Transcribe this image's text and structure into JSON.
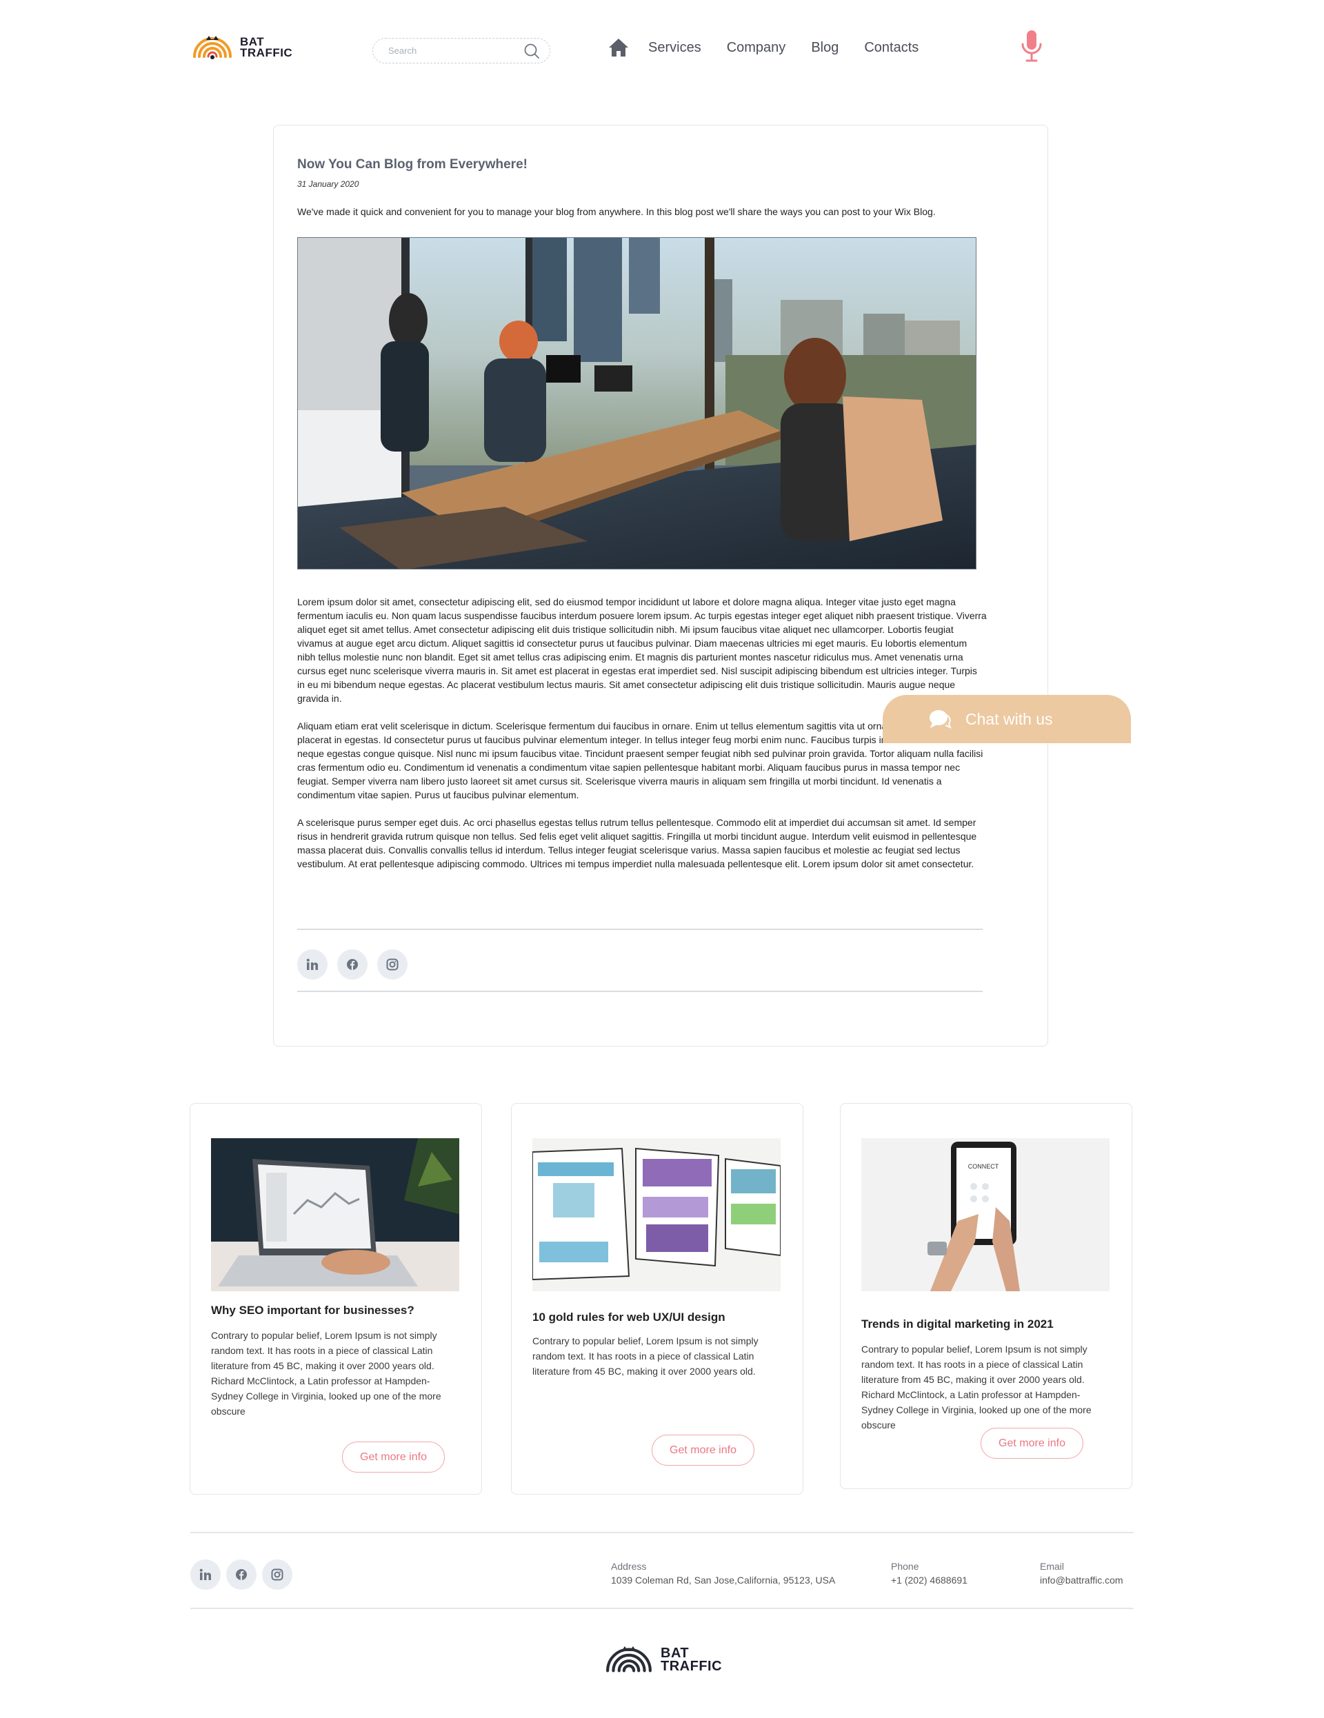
{
  "brand": {
    "name_line1": "BAT",
    "name_line2": "TRAFFIC"
  },
  "search": {
    "placeholder": "Search"
  },
  "nav": {
    "home_icon": "home-icon",
    "items": [
      {
        "label": "Services"
      },
      {
        "label": "Company"
      },
      {
        "label": "Blog"
      },
      {
        "label": "Contacts"
      }
    ]
  },
  "colors": {
    "accent_pink": "#ea7883",
    "chat_bg": "#ecc9a0",
    "logo_orange": "#f29a25",
    "text_dark": "#222222"
  },
  "post": {
    "title": "Now You Can Blog from Everywhere!",
    "date": "31 January 2020",
    "intro": "We've made it quick and convenient for you to manage your blog from anywhere. In this blog post we'll share the ways you can post to your Wix Blog.",
    "paragraphs": [
      "Lorem ipsum dolor sit amet, consectetur adipiscing elit, sed do eiusmod tempor incididunt ut labore et dolore magna aliqua. Integer vitae justo eget magna fermentum iaculis eu. Non quam lacus suspendisse faucibus interdum posuere lorem ipsum. Ac turpis egestas integer eget aliquet nibh praesent tristique. Viverra aliquet eget sit amet tellus. Amet consectetur adipiscing elit duis tristique sollicitudin nibh. Mi ipsum faucibus vitae aliquet nec ullamcorper. Lobortis feugiat vivamus at augue eget arcu dictum. Aliquet sagittis id consectetur purus ut faucibus pulvinar. Diam maecenas ultricies mi eget mauris. Eu lobortis elementum nibh tellus molestie nunc non blandit. Eget sit amet tellus cras adipiscing enim. Et magnis dis parturient montes nascetur ridiculus mus. Amet venenatis urna cursus eget nunc scelerisque viverra mauris in. Sit amet est placerat in egestas erat imperdiet sed. Nisl suscipit adipiscing bibendum est ultricies integer. Turpis in eu mi bibendum neque egestas. Ac placerat vestibulum lectus mauris. Sit amet consectetur adipiscing elit duis tristique sollicitudin. Mauris augue neque gravida in.",
      "Aliquam etiam erat velit scelerisque in dictum. Scelerisque fermentum dui faucibus in ornare. Enim ut tellus elementum sagittis vita ut ornare lectus sit amet est placerat in egestas. Id consectetur purus ut faucibus pulvinar elementum integer. In tellus integer feug morbi enim nunc. Faucibus turpis in eu mi bibendum neque egestas congue quisque. Nisl nunc mi ipsum faucibus vitae. Tincidunt praesent semper feugiat nibh sed pulvinar proin gravida. Tortor aliquam nulla facilisi cras fermentum odio eu. Condimentum id venenatis a condimentum vitae sapien pellentesque habitant morbi. Aliquam faucibus purus in massa tempor nec feugiat. Semper viverra nam libero justo laoreet sit amet cursus sit. Scelerisque viverra mauris in aliquam sem fringilla ut morbi tincidunt. Id venenatis a condimentum vitae sapien. Purus ut faucibus pulvinar elementum.",
      "A scelerisque purus semper eget duis. Ac orci phasellus egestas tellus rutrum tellus pellentesque. Commodo elit at imperdiet dui accumsan sit amet. Id semper risus in hendrerit gravida rutrum quisque non tellus. Sed felis eget velit aliquet sagittis. Fringilla ut morbi tincidunt augue. Interdum velit euismod in pellentesque massa placerat duis. Convallis convallis tellus id interdum. Tellus integer feugiat scelerisque varius. Massa sapien faucibus et molestie ac feugiat sed lectus vestibulum. At erat pellentesque adipiscing commodo. Ultrices mi tempus imperdiet nulla malesuada pellentesque elit. Lorem ipsum dolor sit amet consectetur."
    ],
    "social_icons": [
      "linkedin-icon",
      "facebook-icon",
      "instagram-icon"
    ]
  },
  "chat": {
    "label": "Chat with us",
    "icon": "chat-bubble-icon"
  },
  "related": [
    {
      "title": "Why SEO important for businesses?",
      "text": "Contrary to popular belief, Lorem Ipsum is not simply random text. It has roots in a piece of classical Latin literature from 45 BC, making it over 2000 years old. Richard McClintock, a Latin professor at Hampden-Sydney College in Virginia, looked up one of the more obscure",
      "button": "Get more info"
    },
    {
      "title": "10 gold rules for web UX/UI design",
      "text": "Contrary to popular belief, Lorem Ipsum is not simply random text. It has roots in a piece of classical Latin literature from 45 BC, making it over 2000 years old.",
      "button": "Get more info"
    },
    {
      "title": "Trends in digital marketing in 2021",
      "text": "Contrary to popular belief, Lorem Ipsum is not simply random text. It has roots in a piece of classical Latin literature from 45 BC, making it over 2000 years old. Richard McClintock, a Latin professor at Hampden-Sydney College in Virginia, looked up one of the more obscure",
      "button": "Get more info",
      "tablet_screen_text": "CONNECT"
    }
  ],
  "footer": {
    "address_label": "Address",
    "address_value": "1039 Coleman Rd, San Jose,California,  95123, USA",
    "phone_label": "Phone",
    "phone_value": "+1 (202) 4688691",
    "email_label": "Email",
    "email_value": "info@battraffic.com"
  }
}
